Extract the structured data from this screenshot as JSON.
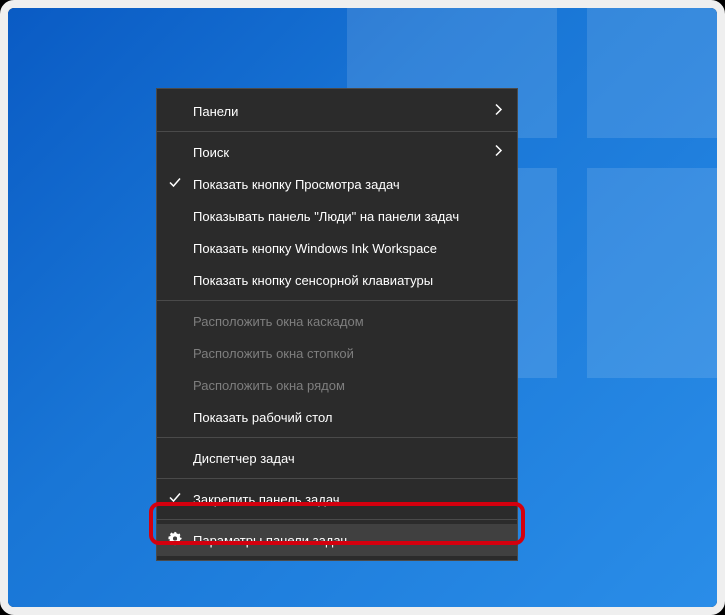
{
  "menu": {
    "items": {
      "panels": {
        "label": "Панели"
      },
      "search": {
        "label": "Поиск"
      },
      "taskview": {
        "label": "Показать кнопку Просмотра задач"
      },
      "people": {
        "label": "Показывать панель \"Люди\" на панели задач"
      },
      "ink": {
        "label": "Показать кнопку Windows Ink Workspace"
      },
      "touchkb": {
        "label": "Показать кнопку сенсорной клавиатуры"
      },
      "cascade": {
        "label": "Расположить окна каскадом"
      },
      "stacked": {
        "label": "Расположить окна стопкой"
      },
      "sidebyside": {
        "label": "Расположить окна рядом"
      },
      "showdesktop": {
        "label": "Показать рабочий стол"
      },
      "taskmgr": {
        "label": "Диспетчер задач"
      },
      "lock": {
        "label": "Закрепить панель задач"
      },
      "settings": {
        "label": "Параметры панели задач"
      }
    }
  },
  "colors": {
    "highlight": "#d4000e",
    "menu_bg": "#2b2b2b",
    "menu_hover": "#404040",
    "desktop_accent": "#1976d6"
  }
}
